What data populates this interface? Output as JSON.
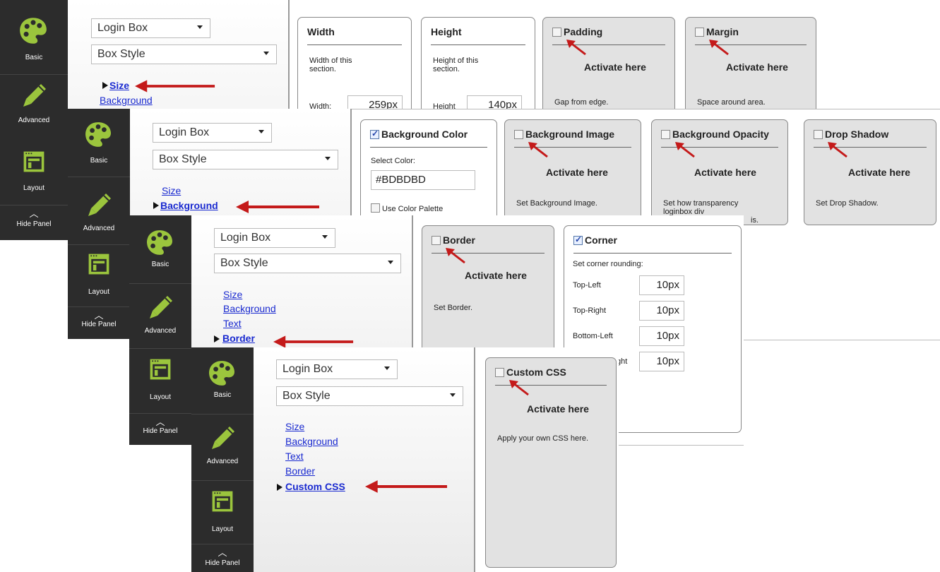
{
  "panel1": {
    "rail": {
      "basic": "Basic",
      "advanced": "Advanced",
      "layout": "Layout",
      "hide": "Hide Panel"
    },
    "select1": "Login Box",
    "select2": "Box Style",
    "nav": [
      "Size",
      "Background"
    ],
    "cards": {
      "width": {
        "title": "Width",
        "desc": "Width of this section.",
        "label": "Width:",
        "value": "259px"
      },
      "height": {
        "title": "Height",
        "desc": "Height of this section.",
        "label": "Height",
        "value": "140px"
      },
      "padding": {
        "title": "Padding",
        "activate": "Activate here",
        "desc": "Gap from edge."
      },
      "margin": {
        "title": "Margin",
        "activate": "Activate here",
        "desc": "Space around area."
      }
    }
  },
  "panel2": {
    "rail": {
      "basic": "Basic",
      "advanced": "Advanced",
      "layout": "Layout",
      "hide": "Hide Panel"
    },
    "select1": "Login Box",
    "select2": "Box Style",
    "nav": [
      "Size",
      "Background"
    ],
    "cards": {
      "bgcolor": {
        "title": "Background Color",
        "label": "Select Color:",
        "value": "#BDBDBD",
        "palette": "Use Color Palette"
      },
      "bgimage": {
        "title": "Background Image",
        "activate": "Activate here",
        "desc": "Set Background Image."
      },
      "bgopacity": {
        "title": "Background Opacity",
        "activate": "Activate here",
        "desc": "Set how transparency loginbox div",
        "desc_tail": "is."
      },
      "shadow": {
        "title": "Drop Shadow",
        "activate": "Activate here",
        "desc": "Set Drop Shadow."
      }
    }
  },
  "panel3": {
    "rail": {
      "basic": "Basic",
      "advanced": "Advanced",
      "layout": "Layout",
      "hide": "Hide Panel"
    },
    "select1": "Login Box",
    "select2": "Box Style",
    "nav": [
      "Size",
      "Background",
      "Text",
      "Border"
    ],
    "cards": {
      "border": {
        "title": "Border",
        "activate": "Activate here",
        "desc": "Set Border."
      },
      "corner": {
        "title": "Corner",
        "label": "Set corner rounding:",
        "rows": [
          {
            "label": "Top-Left",
            "value": "10px"
          },
          {
            "label": "Top-Right",
            "value": "10px"
          },
          {
            "label": "Bottom-Left",
            "value": "10px"
          },
          {
            "label": "ght",
            "value": "10px"
          }
        ]
      }
    }
  },
  "panel4": {
    "rail": {
      "basic": "Basic",
      "advanced": "Advanced",
      "layout": "Layout",
      "hide": "Hide Panel"
    },
    "select1": "Login Box",
    "select2": "Box Style",
    "nav": [
      "Size",
      "Background",
      "Text",
      "Border",
      "Custom CSS"
    ],
    "cards": {
      "css": {
        "title": "Custom CSS",
        "activate": "Activate here",
        "desc": "Apply your own CSS here."
      }
    }
  },
  "colors": {
    "rail": "#2c2c2c",
    "icon": "#9bc53d",
    "arrow": "#c41a1a",
    "link": "#1a2ad0",
    "card_off": "#e2e2e2"
  },
  "icons": {
    "basic": "palette-icon",
    "advanced": "pen-icon",
    "layout": "layout-icon",
    "hide": "chevron-up-icon"
  }
}
